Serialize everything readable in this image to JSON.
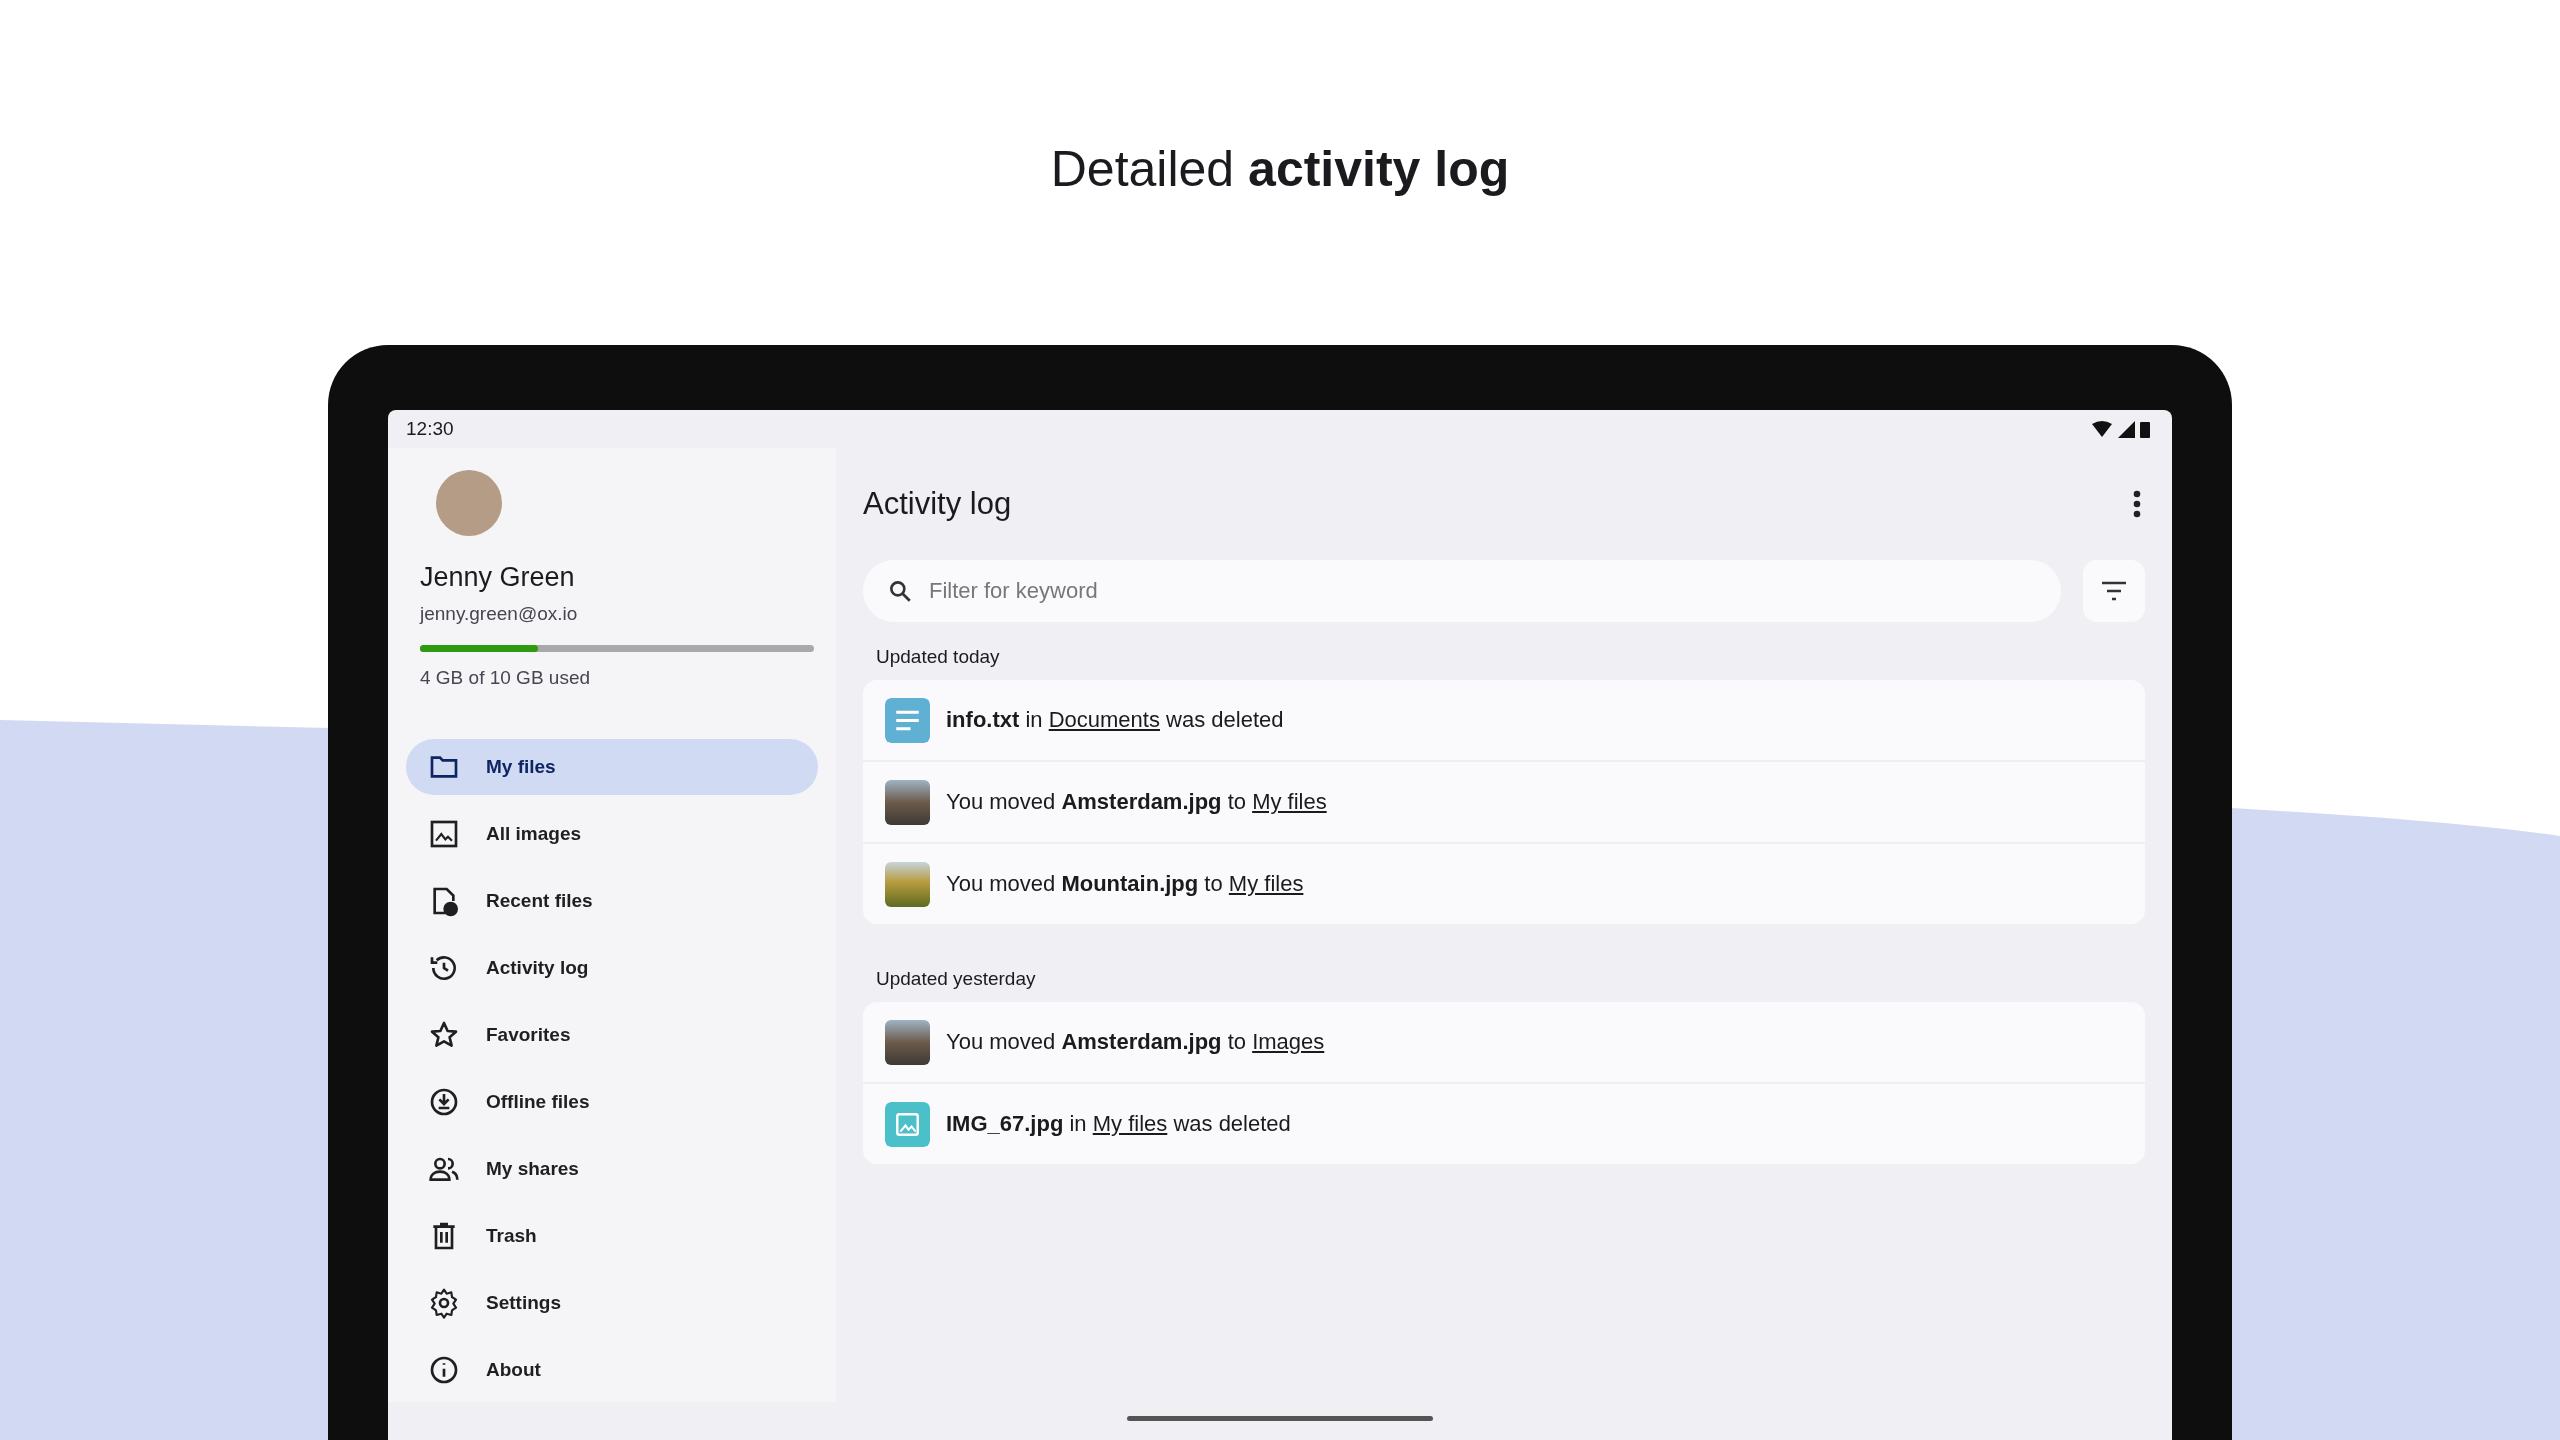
{
  "headline": "Detailed **activity log**",
  "status_bar": {
    "time": "12:30"
  },
  "profile": {
    "name": "Jenny Green",
    "email": "jenny.green@ox.io",
    "storage": {
      "level": 0.3,
      "label": "4 GB of 10 GB used"
    }
  },
  "nav": [
    {
      "label": "My files",
      "selected": true
    },
    {
      "label": "All images",
      "selected": false
    },
    {
      "label": "Recent files",
      "selected": false
    },
    {
      "label": "Activity log",
      "selected": false
    },
    {
      "label": "Favorites",
      "selected": false
    },
    {
      "label": "Offline files",
      "selected": false
    },
    {
      "label": "My shares",
      "selected": false
    },
    {
      "label": "Trash",
      "selected": false
    },
    {
      "label": "Settings",
      "selected": false
    },
    {
      "label": "About",
      "selected": false
    }
  ],
  "main": {
    "title": "Activity log",
    "search": {
      "placeholder": "Filter for keyword"
    },
    "groups": [
      {
        "heading": "Updated today",
        "entries": [
          {
            "kind": "document",
            "parts": [
              {
                "kind": "bold",
                "text": "info.txt"
              },
              {
                "kind": "plain",
                "text": " in "
              },
              {
                "kind": "link",
                "text": "Documents"
              },
              {
                "kind": "plain",
                "text": " was deleted"
              }
            ]
          },
          {
            "kind": "city",
            "parts": [
              {
                "kind": "plain",
                "text": "You moved "
              },
              {
                "kind": "bold",
                "text": "Amsterdam.jpg"
              },
              {
                "kind": "plain",
                "text": " to "
              },
              {
                "kind": "link",
                "text": "My files"
              }
            ]
          },
          {
            "kind": "mountain",
            "parts": [
              {
                "kind": "plain",
                "text": "You moved "
              },
              {
                "kind": "bold",
                "text": "Mountain.jpg"
              },
              {
                "kind": "plain",
                "text": " to "
              },
              {
                "kind": "link",
                "text": "My files"
              }
            ]
          }
        ]
      },
      {
        "heading": "Updated yesterday",
        "entries": [
          {
            "kind": "city",
            "parts": [
              {
                "kind": "plain",
                "text": "You moved "
              },
              {
                "kind": "bold",
                "text": "Amsterdam.jpg"
              },
              {
                "kind": "plain",
                "text": " to "
              },
              {
                "kind": "link",
                "text": "Images"
              }
            ]
          },
          {
            "kind": "picture",
            "parts": [
              {
                "kind": "bold",
                "text": "IMG_67.jpg"
              },
              {
                "kind": "plain",
                "text": " in "
              },
              {
                "kind": "link",
                "text": "My files"
              },
              {
                "kind": "plain",
                "text": " was deleted"
              }
            ]
          }
        ]
      }
    ]
  }
}
